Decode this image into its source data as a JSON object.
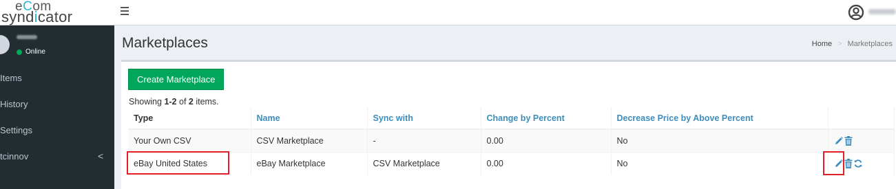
{
  "logo": {
    "line1_pre": "e",
    "line1_accent": "C",
    "line1_post": "om",
    "line2_pre": "synd",
    "line2_accent": "i",
    "line2_post": "cator"
  },
  "sidebar": {
    "status": "Online",
    "items": [
      {
        "label": "Items"
      },
      {
        "label": "History"
      },
      {
        "label": "Settings"
      },
      {
        "label": "tcinnov",
        "caret": "<"
      }
    ]
  },
  "header": {
    "title": "Marketplaces",
    "breadcrumb": [
      "Home",
      ">",
      "Marketplaces"
    ]
  },
  "main": {
    "create_button": "Create Marketplace",
    "summary": {
      "prefix": "Showing ",
      "range": "1-2",
      "mid": " of ",
      "total": "2",
      "suffix": " items."
    },
    "table": {
      "headers": [
        "Type",
        "Name",
        "Sync with",
        "Change by Percent",
        "Decrease Price by Above Percent"
      ],
      "rows": [
        {
          "type": "Your Own CSV",
          "name": "CSV Marketplace",
          "sync": "-",
          "change": "0.00",
          "decrease": "No",
          "actions": [
            "edit",
            "delete"
          ]
        },
        {
          "type": "eBay United States",
          "name": "eBay Marketplace",
          "sync": "CSV Marketplace",
          "change": "0.00",
          "decrease": "No",
          "actions": [
            "edit",
            "delete",
            "sync"
          ]
        }
      ]
    }
  },
  "colors": {
    "accent": "#3c8dbc",
    "primary_green": "#00a65a",
    "sidebar_bg": "#222d32",
    "highlight_red": "#e41e26",
    "logo_accent": "#2bb3d8"
  },
  "icons": {
    "menu": "hamburger-icon",
    "user": "user-circle-icon",
    "edit": "pencil-icon",
    "delete": "trash-icon",
    "sync": "refresh-icon"
  }
}
